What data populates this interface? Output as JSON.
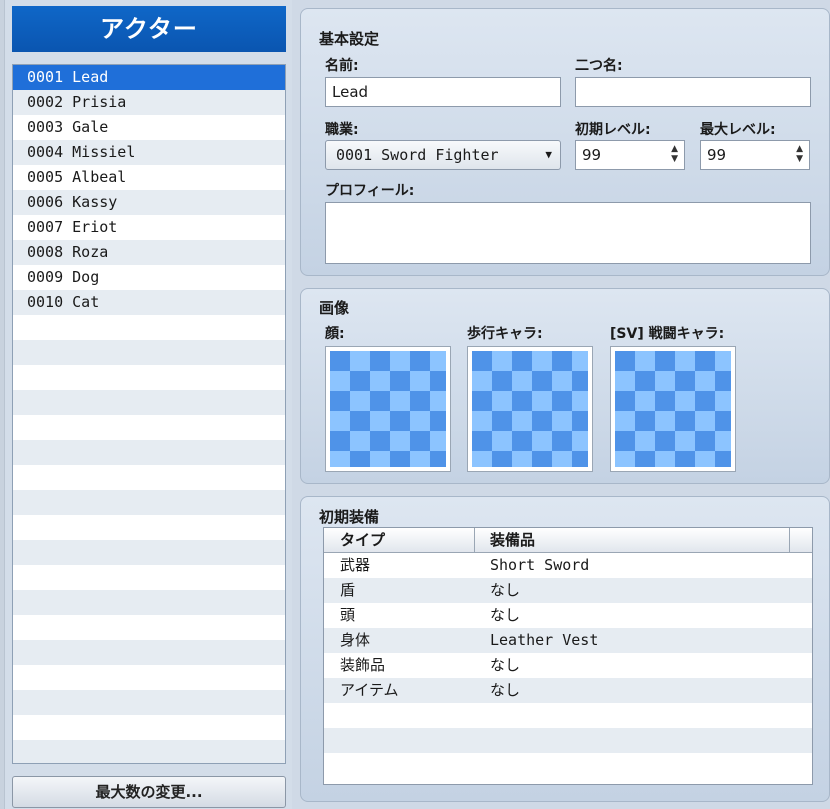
{
  "actors": {
    "header": "アクター",
    "items": [
      {
        "label": "0001 Lead"
      },
      {
        "label": "0002 Prisia"
      },
      {
        "label": "0003 Gale"
      },
      {
        "label": "0004 Missiel"
      },
      {
        "label": "0005 Albeal"
      },
      {
        "label": "0006 Kassy"
      },
      {
        "label": "0007 Eriot"
      },
      {
        "label": "0008 Roza"
      },
      {
        "label": "0009 Dog"
      },
      {
        "label": "0010 Cat"
      }
    ],
    "selected_index": 0,
    "max_button": "最大数の変更..."
  },
  "basic": {
    "title": "基本設定",
    "name_label": "名前:",
    "name_value": "Lead",
    "nickname_label": "二つ名:",
    "nickname_value": "",
    "class_label": "職業:",
    "class_value": "0001 Sword Fighter",
    "initial_level_label": "初期レベル:",
    "initial_level_value": "99",
    "max_level_label": "最大レベル:",
    "max_level_value": "99",
    "profile_label": "プロフィール:",
    "profile_value": ""
  },
  "images": {
    "title": "画像",
    "face_label": "顔:",
    "walk_label": "歩行キャラ:",
    "sv_label": "[SV] 戦闘キャラ:"
  },
  "equipment": {
    "title": "初期装備",
    "col_type": "タイプ",
    "col_item": "装備品",
    "rows": [
      {
        "type": "武器",
        "item": "Short Sword"
      },
      {
        "type": "盾",
        "item": "なし"
      },
      {
        "type": "頭",
        "item": "なし"
      },
      {
        "type": "身体",
        "item": "Leather Vest"
      },
      {
        "type": "装飾品",
        "item": "なし"
      },
      {
        "type": "アイテム",
        "item": "なし"
      }
    ]
  },
  "icons": {
    "dropdown": "chevron-down-icon",
    "spin": "spin-arrows-icon"
  },
  "colors": {
    "accent": "#0f67c8",
    "selection": "#1f6fd9"
  }
}
